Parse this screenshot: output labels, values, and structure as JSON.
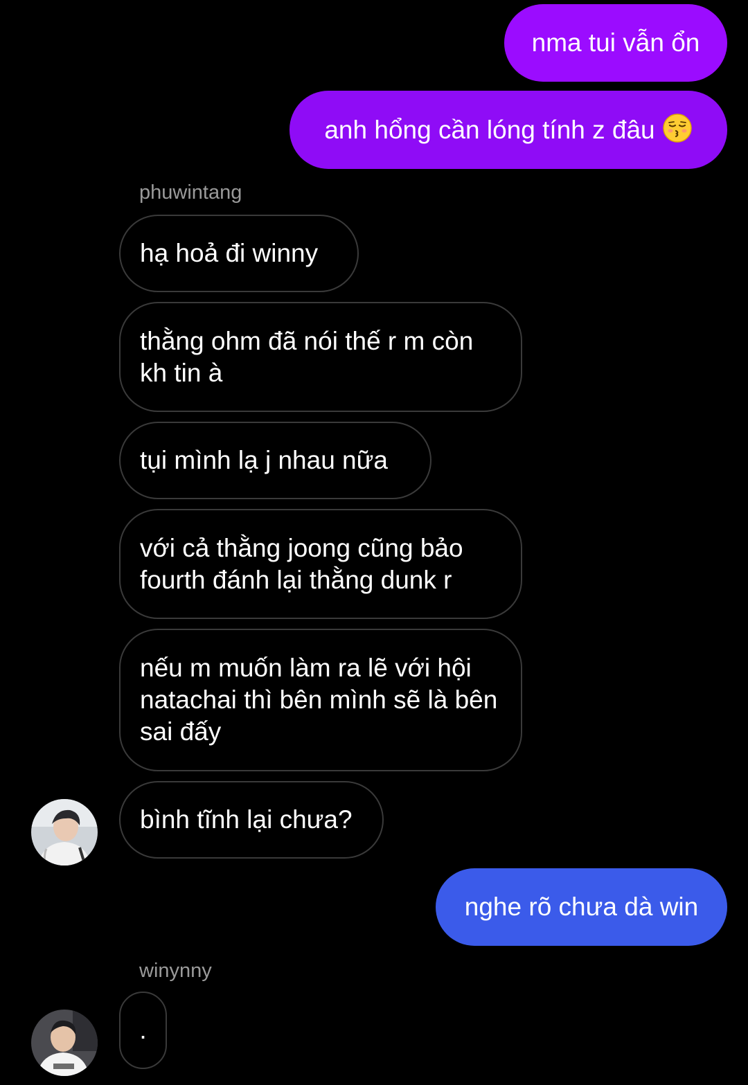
{
  "colors": {
    "background": "#000000",
    "sent_purple": "#9b0cff",
    "sent_blue": "#3b5bea",
    "received_border": "#3a3a3a",
    "sender_label": "#9a9a9a"
  },
  "messages": {
    "m1": {
      "direction": "sent",
      "text": "nma tui vẫn ổn"
    },
    "m2": {
      "direction": "sent",
      "text": "anh hổng cần lóng tính z đâu",
      "emoji": "kissing-face-with-closed-eyes-icon"
    },
    "sender1": "phuwintang",
    "m3": {
      "direction": "received",
      "text": "hạ hoả đi winny"
    },
    "m4": {
      "direction": "received",
      "text": "thằng ohm đã nói thế r m còn kh tin à"
    },
    "m5": {
      "direction": "received",
      "text": "tụi mình lạ j nhau nữa"
    },
    "m6": {
      "direction": "received",
      "text": "với cả thằng joong cũng bảo fourth đánh lại thằng dunk r"
    },
    "m7": {
      "direction": "received",
      "text": "nếu m muốn làm ra lẽ với hội natachai thì bên mình sẽ là bên sai đấy"
    },
    "m8": {
      "direction": "received",
      "text": "bình tĩnh lại chưa?"
    },
    "m9": {
      "direction": "sent",
      "text": "nghe rõ chưa dà win"
    },
    "sender2": "winynny",
    "m10": {
      "direction": "received",
      "text": "."
    }
  },
  "avatars": {
    "phuwintang": "avatar-phuwintang",
    "winynny": "avatar-winynny"
  }
}
